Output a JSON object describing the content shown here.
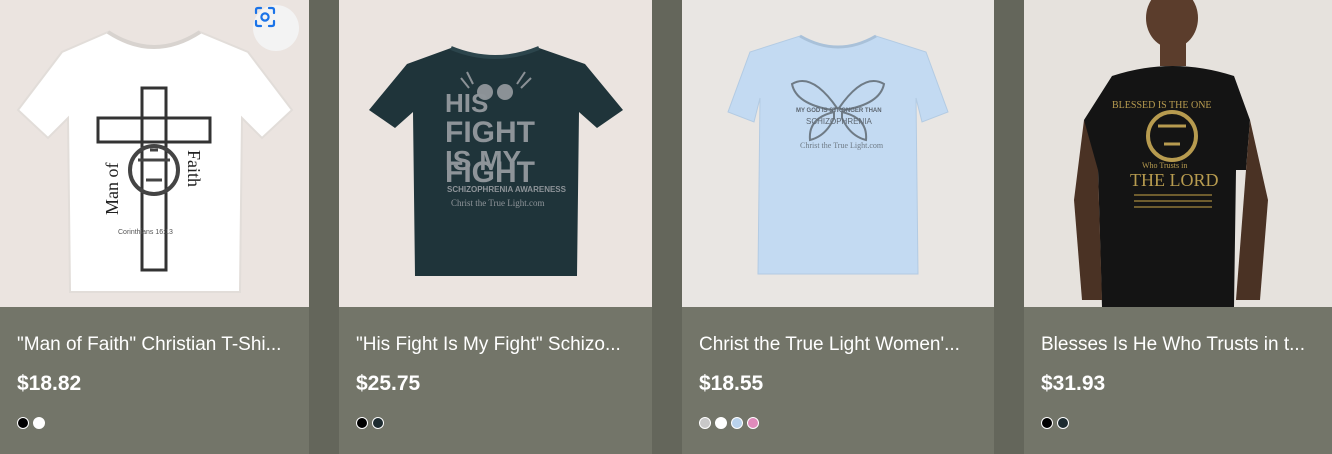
{
  "products": [
    {
      "title": "\"Man of Faith\" Christian T-Shi...",
      "price": "$18.82",
      "image_text": [
        "Man of",
        "Faith",
        "Corinthians 16:13"
      ],
      "swatches": [
        "#000000",
        "#ffffff"
      ]
    },
    {
      "title": "\"His Fight Is My Fight\" Schizo...",
      "price": "$25.75",
      "image_text": [
        "HIS",
        "FIGHT",
        "IS MY",
        "FIGHT",
        "SCHIZOPHRENIA AWARENESS",
        "Christ the True Light.com"
      ],
      "swatches": [
        "#000000",
        "#1d2b30"
      ]
    },
    {
      "title": "Christ the True Light Women'...",
      "price": "$18.55",
      "image_text": [
        "MY GOD IS STRONGER THAN",
        "SCHIZOPHRENIA",
        "Christ the True Light.com"
      ],
      "swatches": [
        "#c8c8c8",
        "#ffffff",
        "#b9d2ec",
        "#e08bbb"
      ]
    },
    {
      "title": "Blesses Is He Who Trusts in t...",
      "price": "$31.93",
      "image_text": [
        "BLESSED IS THE ONE",
        "Who Trusts in",
        "THE LORD"
      ],
      "swatches": [
        "#000000",
        "#1d2b30"
      ]
    }
  ],
  "lens_button": {
    "icon": "google-lens-icon",
    "accent": "#1a73e8"
  }
}
